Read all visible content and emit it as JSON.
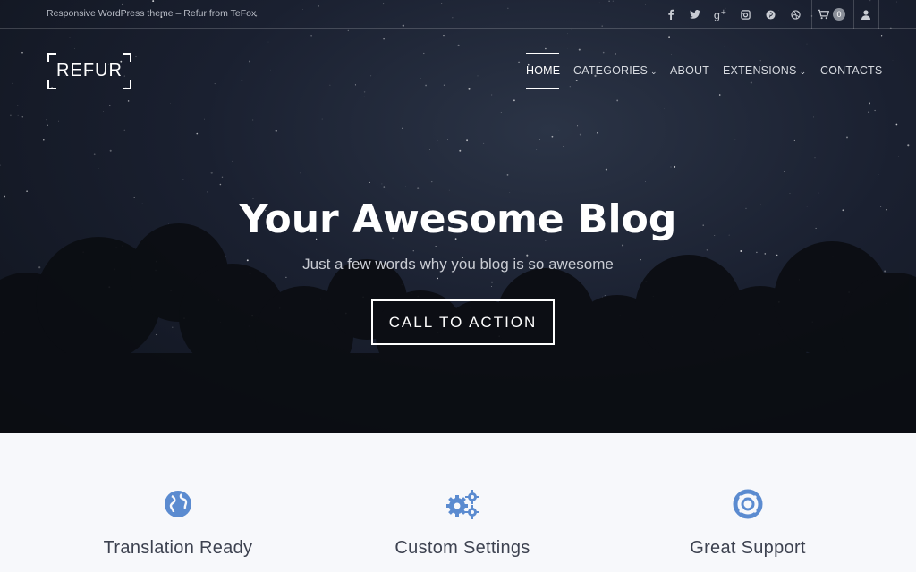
{
  "topbar": {
    "tagline": "Responsive WordPress theme – Refur from TeFox",
    "social_icons": [
      "facebook-icon",
      "twitter-icon",
      "google-plus-icon",
      "instagram-icon",
      "pinterest-icon",
      "dribbble-icon"
    ],
    "cart_count": "0"
  },
  "logo": {
    "text": "REFUR"
  },
  "nav": {
    "items": [
      {
        "label": "HOME",
        "active": true
      },
      {
        "label": "CATEGORIES",
        "dropdown": true
      },
      {
        "label": "ABOUT"
      },
      {
        "label": "EXTENSIONS",
        "dropdown": true
      },
      {
        "label": "CONTACTS"
      }
    ]
  },
  "hero": {
    "title": "Your Awesome Blog",
    "subtitle": "Just a few words why you blog is so awesome",
    "cta_label": "CALL TO ACTION"
  },
  "features": [
    {
      "icon": "globe-icon",
      "title": "Translation Ready"
    },
    {
      "icon": "gears-icon",
      "title": "Custom Settings"
    },
    {
      "icon": "life-ring-icon",
      "title": "Great Support"
    }
  ],
  "colors": {
    "accent_icon": "#5b8bd0",
    "hero_bg": "#1a2030",
    "features_bg": "#f7f8fb"
  }
}
